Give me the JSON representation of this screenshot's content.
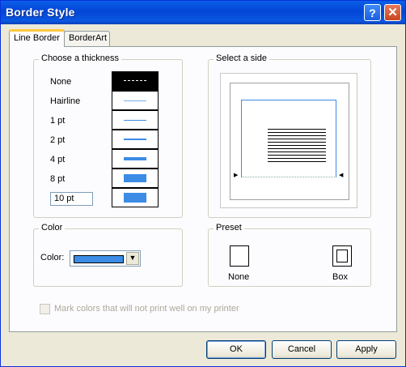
{
  "window": {
    "title": "Border Style",
    "help_glyph": "?",
    "close_glyph": "✕"
  },
  "tabs": [
    {
      "label": "Line Border",
      "selected": true
    },
    {
      "label": "BorderArt",
      "selected": false
    }
  ],
  "thickness": {
    "legend": "Choose a thickness",
    "items": [
      "None",
      "Hairline",
      "1 pt",
      "2 pt",
      "4 pt",
      "8 pt"
    ],
    "custom_value": "10 pt",
    "selected": "None"
  },
  "side": {
    "legend": "Select a side"
  },
  "color": {
    "legend": "Color",
    "label": "Color:",
    "value": "#3c8ce6"
  },
  "preset": {
    "legend": "Preset",
    "items": [
      "None",
      "Box"
    ]
  },
  "checkbox": {
    "label": "Mark colors that will not print well on my printer",
    "checked": false,
    "enabled": false
  },
  "buttons": {
    "ok": "OK",
    "cancel": "Cancel",
    "apply": "Apply"
  }
}
